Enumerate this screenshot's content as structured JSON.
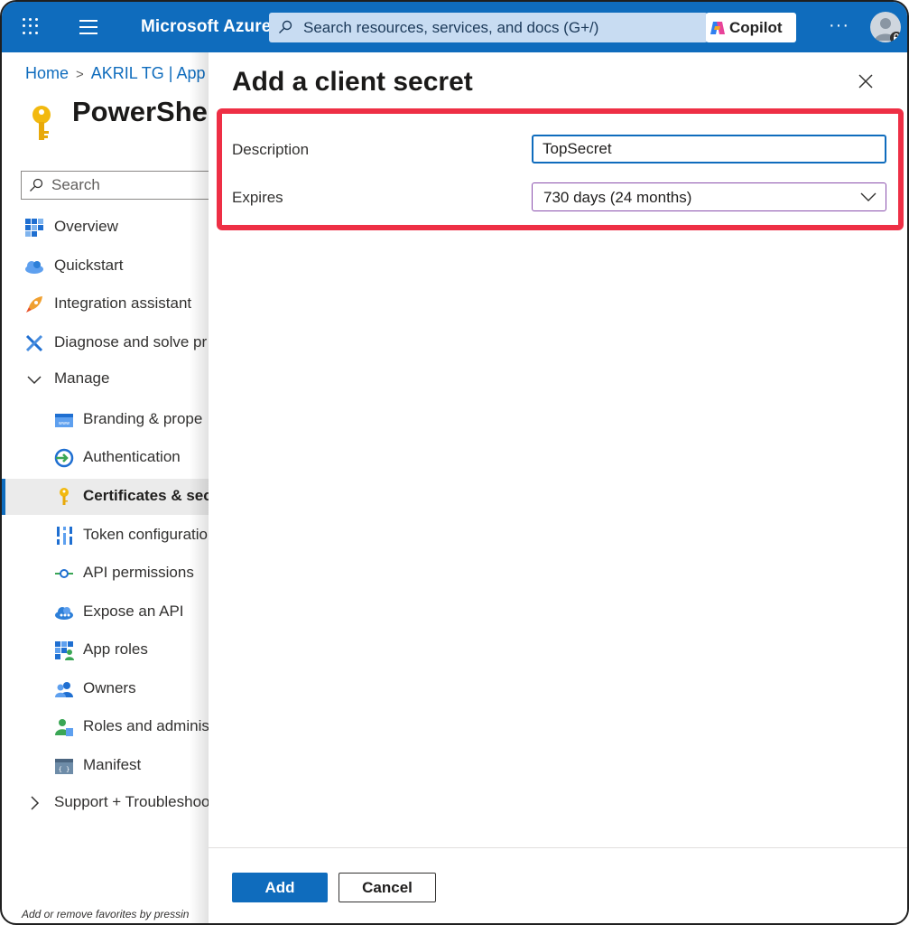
{
  "header": {
    "brand": "Microsoft Azure",
    "search_placeholder": "Search resources, services, and docs (G+/)",
    "copilot_label": "Copilot",
    "more_label": "···"
  },
  "breadcrumb": {
    "items": [
      "Home",
      "AKRIL TG | App"
    ]
  },
  "blade": {
    "title": "PowerShel",
    "search_placeholder": "Search",
    "footnote": "Add or remove favorites by pressin"
  },
  "nav": {
    "overview": "Overview",
    "quickstart": "Quickstart",
    "integration_assistant": "Integration assistant",
    "diagnose": "Diagnose and solve pr",
    "manage": "Manage",
    "branding": "Branding & prope",
    "authentication": "Authentication",
    "certificates": "Certificates & secr",
    "token_configuration": "Token configuratio",
    "api_permissions": "API permissions",
    "expose_api": "Expose an API",
    "app_roles": "App roles",
    "owners": "Owners",
    "roles_admins": "Roles and adminis",
    "manifest": "Manifest",
    "support": "Support + Troubleshoo"
  },
  "panel": {
    "title": "Add a client secret",
    "description_label": "Description",
    "description_value": "TopSecret",
    "expires_label": "Expires",
    "expires_value": "730 days (24 months)",
    "add_label": "Add",
    "cancel_label": "Cancel"
  },
  "colors": {
    "azure_blue": "#0f6cbd",
    "highlight_red": "#ee2f45"
  }
}
